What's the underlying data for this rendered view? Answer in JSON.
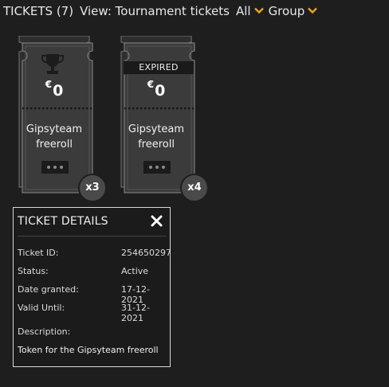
{
  "header": {
    "title": "TICKETS (7)",
    "view_label": "View: Tournament tickets",
    "filter_value": "All",
    "group_label": "Group",
    "accent_color": "#e8a317"
  },
  "tickets": [
    {
      "icon": "trophy-icon",
      "currency": "€",
      "amount": "0",
      "name_line1": "Gipsyteam",
      "name_line2": "freeroll",
      "count": "x3",
      "expired_label": ""
    },
    {
      "icon": "",
      "currency": "€",
      "amount": "0",
      "name_line1": "Gipsyteam",
      "name_line2": "freeroll",
      "count": "x4",
      "expired_label": "EXPIRED"
    }
  ],
  "details": {
    "title": "TICKET DETAILS",
    "fields": [
      {
        "label": "Ticket ID:",
        "value": "254650297"
      },
      {
        "label": "Status:",
        "value": "Active"
      },
      {
        "label": "Date granted:",
        "value": "17-12-2021"
      },
      {
        "label": "Valid Until:",
        "value": "31-12-2021"
      }
    ],
    "description_label": "Description:",
    "description": "Token for the Gipsyteam freeroll"
  }
}
